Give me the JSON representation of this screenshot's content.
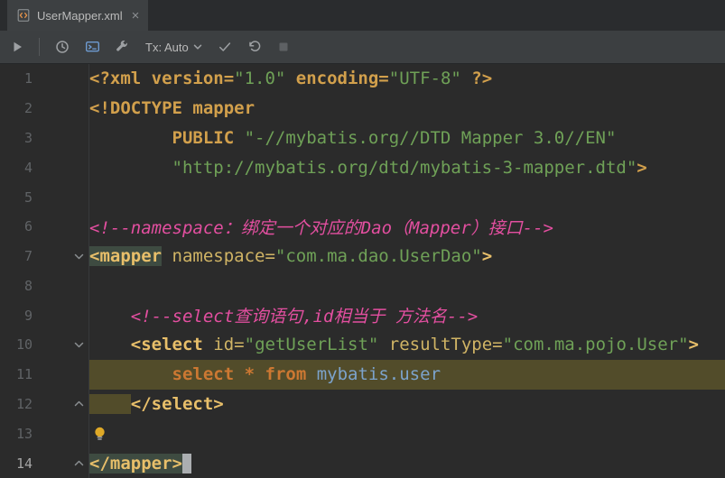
{
  "colors": {
    "bg": "#2B2B2B",
    "tabbar_bg": "#2A2C2E",
    "tab_bg": "#3D4042",
    "tab_fg": "#BBBBBB",
    "toolbar_bg": "#3C3F41",
    "toolbar_fg": "#BBBBBB",
    "toolbar_border": "#242628",
    "sep": "#55585A",
    "gutter_fg": "#606366",
    "gutter_fg_active": "#A4A4A4",
    "gutter_border": "#37393B",
    "decl": "#D2A04C",
    "tag": "#E8BF6A",
    "attr": "#D0B465",
    "str": "#6FA157",
    "com": "#E34FA0",
    "sqlkw": "#CC7832",
    "sqlref": "#7CA3CC",
    "plain": "#A9B7C6",
    "inject_bg": "#524C2A",
    "match_bg": "#3E4B41",
    "caret": "#ABAEB1",
    "icon_gray": "#9DA0A3",
    "icon_blue": "#6E9BD1",
    "icon_disabled": "#5E6164",
    "bulb": "#DFA927",
    "fold_icon": "#8A8E91",
    "file_icon_stroke": "#8A8E90",
    "file_icon_brackets": "#E8944A"
  },
  "tab": {
    "title": "UserMapper.xml",
    "close_label": "×",
    "icon": "xml-file-icon"
  },
  "toolbar": {
    "tx_label": "Tx: Auto",
    "icon_names": [
      "run-icon",
      "query-history-icon",
      "console-sessions-icon",
      "settings-wrench-icon",
      "tx-dropdown-chevron-icon",
      "commit-icon",
      "rollback-icon",
      "stop-icon"
    ]
  },
  "editor": {
    "lines": [
      {
        "num": 1,
        "tokens": [
          {
            "t": "<?xml version=",
            "c": "decl"
          },
          {
            "t": "\"1.0\"",
            "c": "str"
          },
          {
            "t": " encoding=",
            "c": "decl"
          },
          {
            "t": "\"UTF-8\"",
            "c": "str"
          },
          {
            "t": " ?>",
            "c": "decl"
          }
        ]
      },
      {
        "num": 2,
        "tokens": [
          {
            "t": "<!DOCTYPE mapper",
            "c": "decl"
          }
        ]
      },
      {
        "num": 3,
        "tokens": [
          {
            "t": "        ",
            "c": "plain"
          },
          {
            "t": "PUBLIC ",
            "c": "decl"
          },
          {
            "t": "\"-//mybatis.org//DTD Mapper 3.0//EN\"",
            "c": "str"
          }
        ]
      },
      {
        "num": 4,
        "tokens": [
          {
            "t": "        ",
            "c": "plain"
          },
          {
            "t": "\"http://mybatis.org/dtd/mybatis-3-mapper.dtd\"",
            "c": "str"
          },
          {
            "t": ">",
            "c": "decl"
          }
        ]
      },
      {
        "num": 5,
        "tokens": []
      },
      {
        "num": 6,
        "tokens": [
          {
            "t": "<!--namespace：绑定一个对应的Dao（Mapper）接口-->",
            "c": "com"
          }
        ]
      },
      {
        "num": 7,
        "fold": "down",
        "tokens": [
          {
            "t": "<mapper",
            "c": "tag",
            "bg": "match"
          },
          {
            "t": " ",
            "c": "plain"
          },
          {
            "t": "namespace=",
            "c": "attr"
          },
          {
            "t": "\"com.ma.dao.UserDao\"",
            "c": "str"
          },
          {
            "t": ">",
            "c": "tag"
          }
        ]
      },
      {
        "num": 8,
        "tokens": []
      },
      {
        "num": 9,
        "tokens": [
          {
            "t": "    ",
            "c": "plain"
          },
          {
            "t": "<!--select查询语句,id相当于 方法名-->",
            "c": "com"
          }
        ]
      },
      {
        "num": 10,
        "fold": "down",
        "tokens": [
          {
            "t": "    ",
            "c": "plain"
          },
          {
            "t": "<select",
            "c": "tag"
          },
          {
            "t": " ",
            "c": "plain"
          },
          {
            "t": "id=",
            "c": "attr"
          },
          {
            "t": "\"getUserList\"",
            "c": "str"
          },
          {
            "t": " ",
            "c": "plain"
          },
          {
            "t": "resultType=",
            "c": "attr"
          },
          {
            "t": "\"com.ma.pojo.User\"",
            "c": "str"
          },
          {
            "t": ">",
            "c": "tag"
          }
        ]
      },
      {
        "num": 11,
        "full_bg": true,
        "tokens": [
          {
            "t": "        ",
            "c": "plain"
          },
          {
            "t": "select",
            "c": "sqlkw"
          },
          {
            "t": " ",
            "c": "plain"
          },
          {
            "t": "*",
            "c": "sqlkw"
          },
          {
            "t": " ",
            "c": "plain"
          },
          {
            "t": "from",
            "c": "sqlkw"
          },
          {
            "t": " ",
            "c": "plain"
          },
          {
            "t": "mybatis.user",
            "c": "sqlref"
          }
        ]
      },
      {
        "num": 12,
        "fold": "up",
        "tokens": [
          {
            "t": "    ",
            "c": "plain",
            "bg": "inject"
          },
          {
            "t": "</select>",
            "c": "tag"
          }
        ]
      },
      {
        "num": 13,
        "bulb": true,
        "tokens": []
      },
      {
        "num": 14,
        "fold": "up",
        "cursor": true,
        "active": true,
        "tokens": [
          {
            "t": "</mapper>",
            "c": "tag",
            "bg": "match"
          }
        ]
      }
    ]
  }
}
